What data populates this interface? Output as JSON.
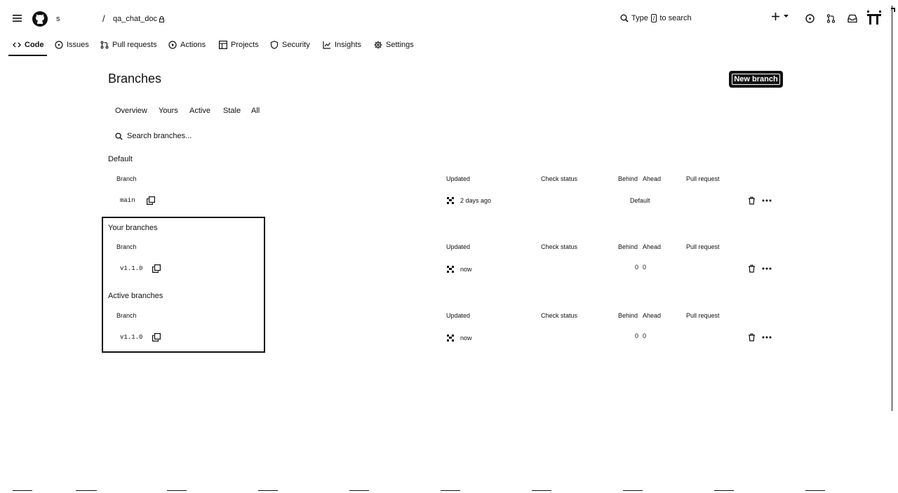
{
  "header": {
    "owner": "s",
    "repo_name": "qa_chat_doc",
    "search_placeholder_prefix": "Type",
    "search_key": "/",
    "search_placeholder_suffix": "to search"
  },
  "repo_tabs": [
    {
      "label": "Code",
      "icon": "code-icon"
    },
    {
      "label": "Issues",
      "icon": "issue-icon"
    },
    {
      "label": "Pull requests",
      "icon": "pull-request-icon"
    },
    {
      "label": "Actions",
      "icon": "play-icon"
    },
    {
      "label": "Projects",
      "icon": "table-icon"
    },
    {
      "label": "Security",
      "icon": "shield-icon"
    },
    {
      "label": "Insights",
      "icon": "graph-icon"
    },
    {
      "label": "Settings",
      "icon": "gear-icon"
    }
  ],
  "page": {
    "title": "Branches",
    "new_branch_label": "New branch"
  },
  "branch_tabs": [
    "Overview",
    "Yours",
    "Active",
    "Stale",
    "All"
  ],
  "search": {
    "placeholder": "Search branches..."
  },
  "columns": {
    "branch": "Branch",
    "updated": "Updated",
    "check_status": "Check status",
    "behind": "Behind",
    "ahead": "Ahead",
    "pull_request": "Pull request"
  },
  "sections": {
    "default": {
      "label": "Default",
      "row": {
        "name": "main",
        "updated": "2 days ago",
        "behind_ahead": "Default"
      }
    },
    "yours": {
      "label": "Your branches",
      "row": {
        "name": "v1.1.0",
        "updated": "now",
        "behind": "0",
        "ahead": "0"
      }
    },
    "active": {
      "label": "Active branches",
      "row": {
        "name": "v1.1.0",
        "updated": "now",
        "behind": "0",
        "ahead": "0"
      }
    }
  }
}
